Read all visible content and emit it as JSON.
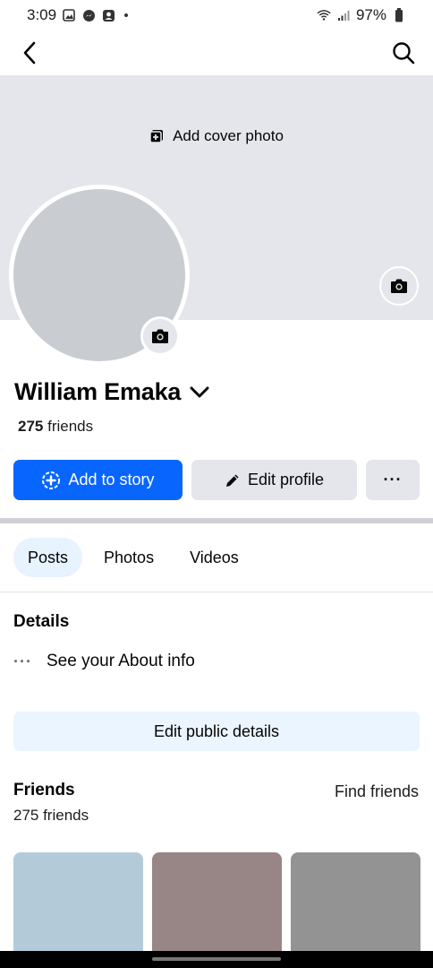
{
  "status_bar": {
    "time": "3:09",
    "battery": "97%",
    "icons": [
      "gallery-icon",
      "messenger-icon",
      "app-icon",
      "wifi-icon",
      "signal-icon",
      "battery-icon"
    ]
  },
  "top_nav": {
    "back_icon": "chevron-left-icon",
    "search_icon": "search-icon"
  },
  "cover": {
    "add_cover_label": "Add cover photo",
    "bg_color": "#e4e6eb"
  },
  "profile": {
    "name": "William Emaka",
    "friends_count": "275",
    "friends_label": "friends"
  },
  "actions": {
    "add_story": "Add to story",
    "edit_profile": "Edit profile",
    "more": "···"
  },
  "tabs": [
    {
      "label": "Posts",
      "active": true
    },
    {
      "label": "Photos",
      "active": false
    },
    {
      "label": "Videos",
      "active": false
    }
  ],
  "details": {
    "title": "Details",
    "about_dots": "···",
    "about_label": "See your About info",
    "edit_public": "Edit public details"
  },
  "friends": {
    "title": "Friends",
    "find_friends": "Find friends",
    "count_text": "275 friends",
    "tile_colors": [
      "#b3cad9",
      "#978685",
      "#939393"
    ]
  },
  "colors": {
    "accent": "#0866ff",
    "secondary_bg": "#e4e6eb",
    "tab_active_bg": "#e7f3ff"
  }
}
